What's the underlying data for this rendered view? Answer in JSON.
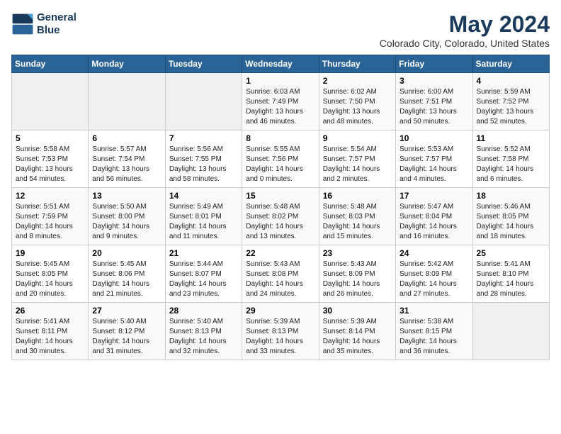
{
  "logo": {
    "line1": "General",
    "line2": "Blue"
  },
  "title": "May 2024",
  "subtitle": "Colorado City, Colorado, United States",
  "days_of_week": [
    "Sunday",
    "Monday",
    "Tuesday",
    "Wednesday",
    "Thursday",
    "Friday",
    "Saturday"
  ],
  "weeks": [
    [
      {
        "num": "",
        "detail": ""
      },
      {
        "num": "",
        "detail": ""
      },
      {
        "num": "",
        "detail": ""
      },
      {
        "num": "1",
        "detail": "Sunrise: 6:03 AM\nSunset: 7:49 PM\nDaylight: 13 hours\nand 46 minutes."
      },
      {
        "num": "2",
        "detail": "Sunrise: 6:02 AM\nSunset: 7:50 PM\nDaylight: 13 hours\nand 48 minutes."
      },
      {
        "num": "3",
        "detail": "Sunrise: 6:00 AM\nSunset: 7:51 PM\nDaylight: 13 hours\nand 50 minutes."
      },
      {
        "num": "4",
        "detail": "Sunrise: 5:59 AM\nSunset: 7:52 PM\nDaylight: 13 hours\nand 52 minutes."
      }
    ],
    [
      {
        "num": "5",
        "detail": "Sunrise: 5:58 AM\nSunset: 7:53 PM\nDaylight: 13 hours\nand 54 minutes."
      },
      {
        "num": "6",
        "detail": "Sunrise: 5:57 AM\nSunset: 7:54 PM\nDaylight: 13 hours\nand 56 minutes."
      },
      {
        "num": "7",
        "detail": "Sunrise: 5:56 AM\nSunset: 7:55 PM\nDaylight: 13 hours\nand 58 minutes."
      },
      {
        "num": "8",
        "detail": "Sunrise: 5:55 AM\nSunset: 7:56 PM\nDaylight: 14 hours\nand 0 minutes."
      },
      {
        "num": "9",
        "detail": "Sunrise: 5:54 AM\nSunset: 7:57 PM\nDaylight: 14 hours\nand 2 minutes."
      },
      {
        "num": "10",
        "detail": "Sunrise: 5:53 AM\nSunset: 7:57 PM\nDaylight: 14 hours\nand 4 minutes."
      },
      {
        "num": "11",
        "detail": "Sunrise: 5:52 AM\nSunset: 7:58 PM\nDaylight: 14 hours\nand 6 minutes."
      }
    ],
    [
      {
        "num": "12",
        "detail": "Sunrise: 5:51 AM\nSunset: 7:59 PM\nDaylight: 14 hours\nand 8 minutes."
      },
      {
        "num": "13",
        "detail": "Sunrise: 5:50 AM\nSunset: 8:00 PM\nDaylight: 14 hours\nand 9 minutes."
      },
      {
        "num": "14",
        "detail": "Sunrise: 5:49 AM\nSunset: 8:01 PM\nDaylight: 14 hours\nand 11 minutes."
      },
      {
        "num": "15",
        "detail": "Sunrise: 5:48 AM\nSunset: 8:02 PM\nDaylight: 14 hours\nand 13 minutes."
      },
      {
        "num": "16",
        "detail": "Sunrise: 5:48 AM\nSunset: 8:03 PM\nDaylight: 14 hours\nand 15 minutes."
      },
      {
        "num": "17",
        "detail": "Sunrise: 5:47 AM\nSunset: 8:04 PM\nDaylight: 14 hours\nand 16 minutes."
      },
      {
        "num": "18",
        "detail": "Sunrise: 5:46 AM\nSunset: 8:05 PM\nDaylight: 14 hours\nand 18 minutes."
      }
    ],
    [
      {
        "num": "19",
        "detail": "Sunrise: 5:45 AM\nSunset: 8:05 PM\nDaylight: 14 hours\nand 20 minutes."
      },
      {
        "num": "20",
        "detail": "Sunrise: 5:45 AM\nSunset: 8:06 PM\nDaylight: 14 hours\nand 21 minutes."
      },
      {
        "num": "21",
        "detail": "Sunrise: 5:44 AM\nSunset: 8:07 PM\nDaylight: 14 hours\nand 23 minutes."
      },
      {
        "num": "22",
        "detail": "Sunrise: 5:43 AM\nSunset: 8:08 PM\nDaylight: 14 hours\nand 24 minutes."
      },
      {
        "num": "23",
        "detail": "Sunrise: 5:43 AM\nSunset: 8:09 PM\nDaylight: 14 hours\nand 26 minutes."
      },
      {
        "num": "24",
        "detail": "Sunrise: 5:42 AM\nSunset: 8:09 PM\nDaylight: 14 hours\nand 27 minutes."
      },
      {
        "num": "25",
        "detail": "Sunrise: 5:41 AM\nSunset: 8:10 PM\nDaylight: 14 hours\nand 28 minutes."
      }
    ],
    [
      {
        "num": "26",
        "detail": "Sunrise: 5:41 AM\nSunset: 8:11 PM\nDaylight: 14 hours\nand 30 minutes."
      },
      {
        "num": "27",
        "detail": "Sunrise: 5:40 AM\nSunset: 8:12 PM\nDaylight: 14 hours\nand 31 minutes."
      },
      {
        "num": "28",
        "detail": "Sunrise: 5:40 AM\nSunset: 8:13 PM\nDaylight: 14 hours\nand 32 minutes."
      },
      {
        "num": "29",
        "detail": "Sunrise: 5:39 AM\nSunset: 8:13 PM\nDaylight: 14 hours\nand 33 minutes."
      },
      {
        "num": "30",
        "detail": "Sunrise: 5:39 AM\nSunset: 8:14 PM\nDaylight: 14 hours\nand 35 minutes."
      },
      {
        "num": "31",
        "detail": "Sunrise: 5:38 AM\nSunset: 8:15 PM\nDaylight: 14 hours\nand 36 minutes."
      },
      {
        "num": "",
        "detail": ""
      }
    ]
  ]
}
